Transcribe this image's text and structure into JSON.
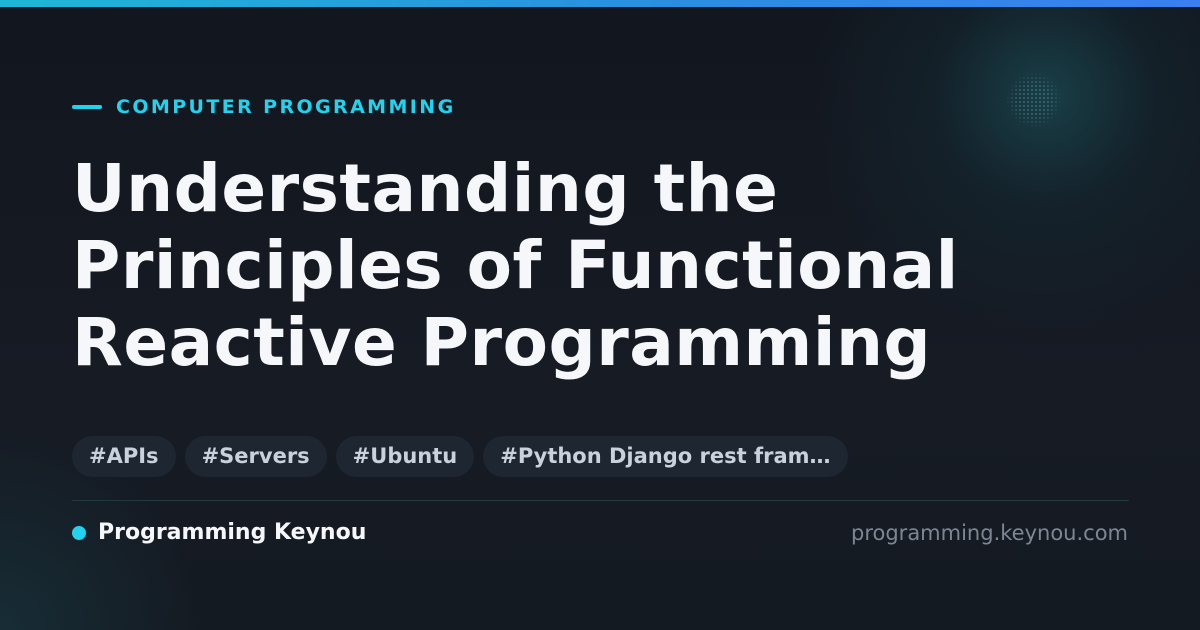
{
  "eyebrow": {
    "text": "COMPUTER PROGRAMMING"
  },
  "title": {
    "lines": [
      "Understanding the",
      "Principles of Functional",
      "Reactive Programming"
    ]
  },
  "tags": [
    "#APIs",
    "#Servers",
    "#Ubuntu",
    "#Python Django rest fram…"
  ],
  "footer": {
    "brand": "Programming Keynou",
    "domain": "programming.keynou.com"
  },
  "colors": {
    "accent": "#22d3ee",
    "background": "#141a22",
    "title": "#f5f7fa",
    "tag_background": "#1e2631",
    "tag_text": "#c9d1dc",
    "muted": "#7d8794"
  }
}
